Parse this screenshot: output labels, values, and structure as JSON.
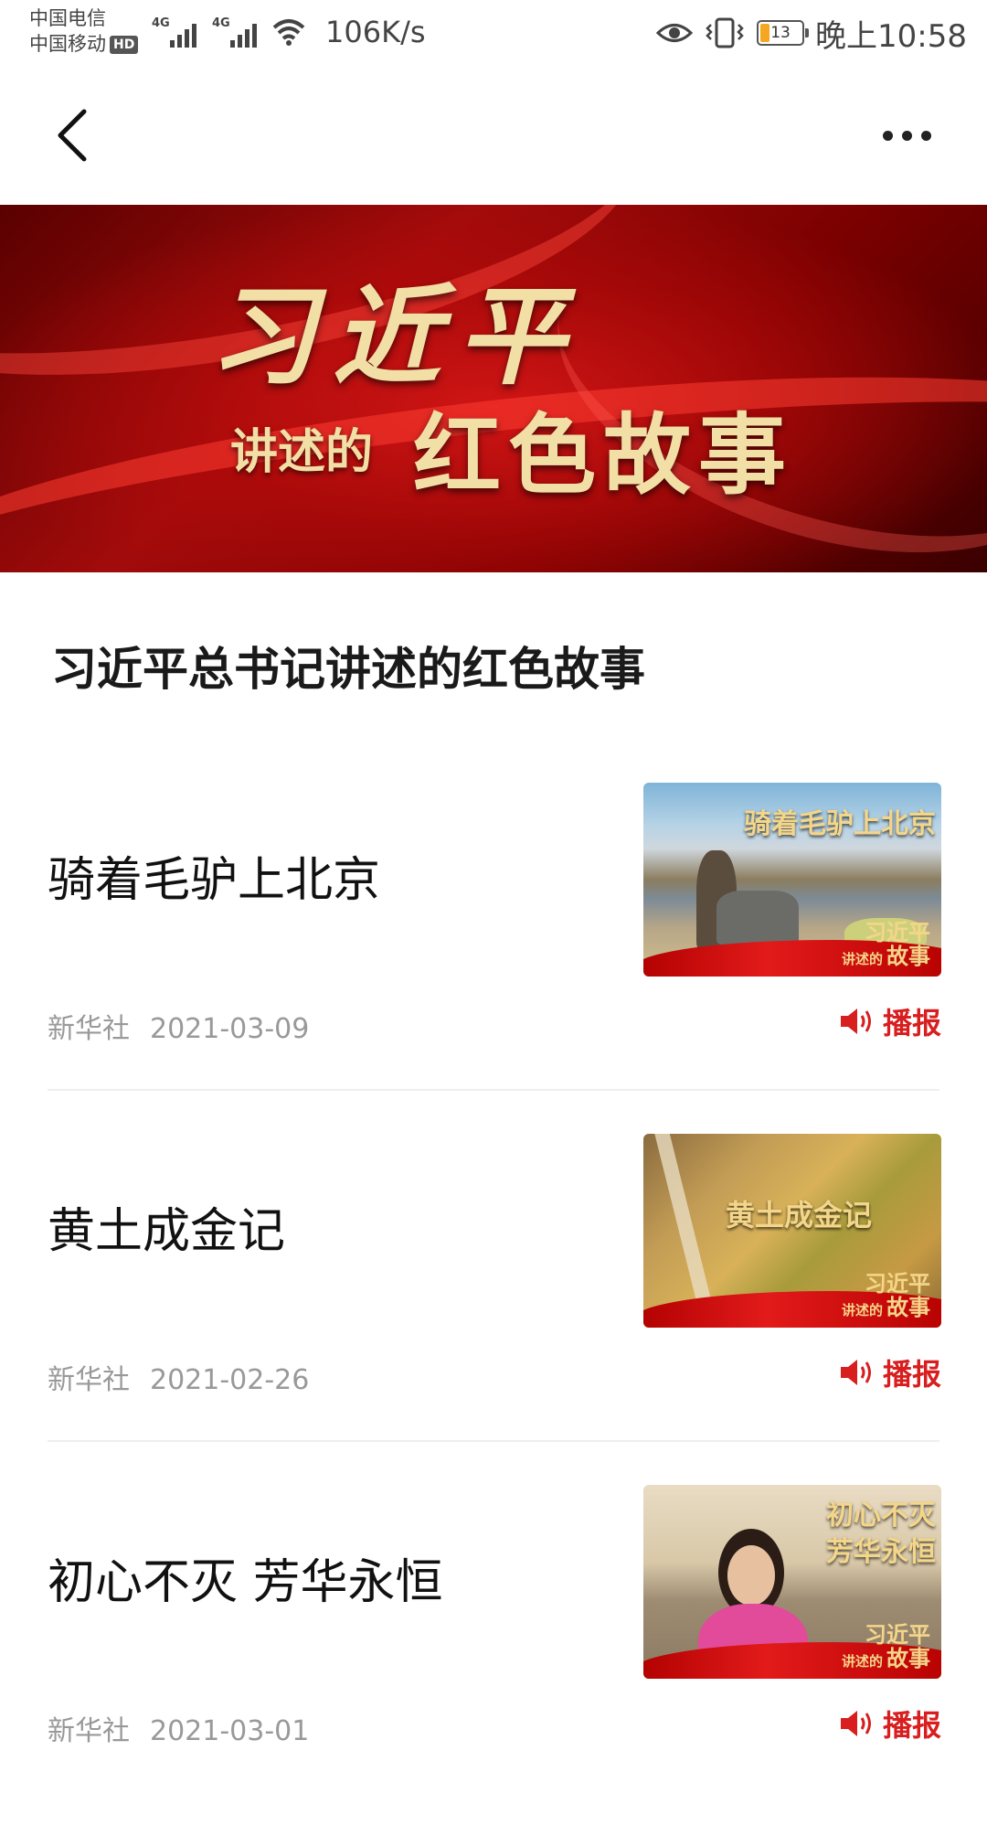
{
  "status_bar": {
    "carrier_1": "中国电信",
    "carrier_2": "中国移动",
    "hd_badge": "HD",
    "net_type_1": "4G",
    "net_type_2": "4G",
    "net_speed": "106K/s",
    "battery": "13",
    "time": "晚上10:58",
    "icons": [
      "signal-icon",
      "signal-icon",
      "wifi-icon",
      "eye-icon",
      "vibrate-icon",
      "battery-icon"
    ]
  },
  "nav": {
    "back_icon": "chevron-left-icon",
    "more_icon": "more-horizontal-icon"
  },
  "banner": {
    "line1": "习近平",
    "line2_small": "讲述的",
    "line2_big": "红色故事"
  },
  "page_title": "习近平总书记讲述的红色故事",
  "articles": [
    {
      "title": "骑着毛驴上北京",
      "source": "新华社",
      "date": "2021-03-09",
      "play_label": "播报",
      "thumb_caption": "骑着毛驴上北京",
      "thumb_brand_1": "习近平",
      "thumb_brand_small": "讲述的",
      "thumb_brand_2": "故事"
    },
    {
      "title": "黄土成金记",
      "source": "新华社",
      "date": "2021-02-26",
      "play_label": "播报",
      "thumb_caption": "黄土成金记",
      "thumb_brand_1": "习近平",
      "thumb_brand_small": "讲述的",
      "thumb_brand_2": "故事"
    },
    {
      "title": "初心不灭 芳华永恒",
      "source": "新华社",
      "date": "2021-03-01",
      "play_label": "播报",
      "thumb_caption_1": "初心不灭",
      "thumb_caption_2": "芳华永恒",
      "thumb_brand_1": "习近平",
      "thumb_brand_small": "讲述的",
      "thumb_brand_2": "故事"
    }
  ],
  "colors": {
    "accent": "#d81e1e",
    "banner_red": "#a20b0b",
    "gold": "#f2dfa6",
    "meta_gray": "#999999"
  }
}
